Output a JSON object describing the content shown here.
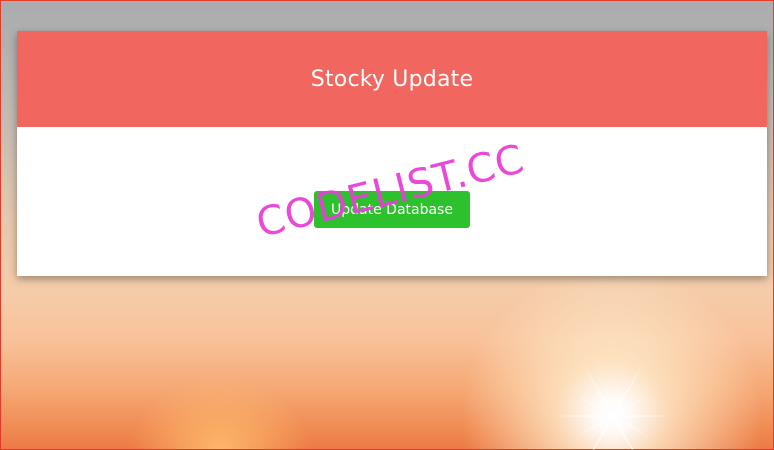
{
  "header": {
    "title": "Stocky Update"
  },
  "actions": {
    "update_label": "Update Database"
  },
  "watermark": {
    "text": "CODELIST.CC"
  },
  "colors": {
    "header_bg": "#f1665f",
    "button_bg": "#2ec12e",
    "watermark": "#e83fd8",
    "page_border": "#e23b2a"
  }
}
